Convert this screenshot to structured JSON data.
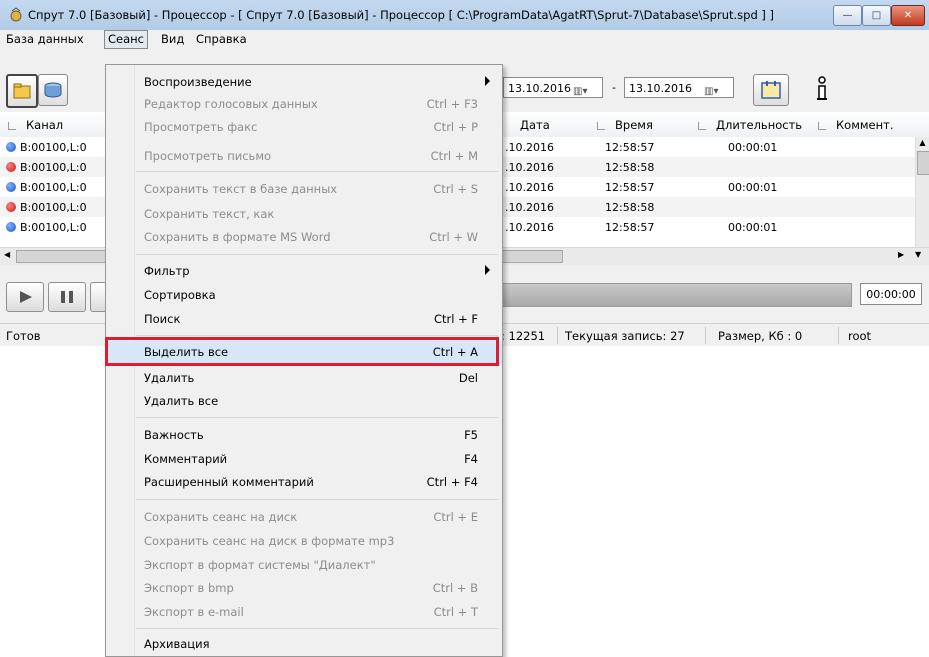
{
  "window": {
    "title": "Спрут 7.0 [Базовый] - Процессор - [ Спрут 7.0 [Базовый] - Процессор [ C:\\ProgramData\\AgatRT\\Sprut-7\\Database\\Sprut.spd ] ]"
  },
  "menubar": {
    "items": [
      "База данных",
      "Сеанс",
      "Вид",
      "Справка"
    ],
    "active": "Сеанс"
  },
  "toolbar": {
    "date_from": "13.10.2016",
    "date_to": "13.10.2016",
    "date_sep": "-"
  },
  "table": {
    "columns": [
      "Канал",
      "Дата",
      "Время",
      "Длительность",
      "Коммент."
    ],
    "rows": [
      {
        "channel": "B:00100,L:0",
        "date": ".10.2016",
        "time": "12:58:57",
        "duration": "00:00:01",
        "status": "blue"
      },
      {
        "channel": "B:00100,L:0",
        "date": ".10.2016",
        "time": "12:58:58",
        "duration": "",
        "status": "red"
      },
      {
        "channel": "B:00100,L:0",
        "date": ".10.2016",
        "time": "12:58:57",
        "duration": "00:00:01",
        "status": "blue"
      },
      {
        "channel": "B:00100,L:0",
        "date": ".10.2016",
        "time": "12:58:58",
        "duration": "",
        "status": "red"
      },
      {
        "channel": "B:00100,L:0",
        "date": ".10.2016",
        "time": "12:58:57",
        "duration": "00:00:01",
        "status": "blue"
      }
    ]
  },
  "player": {
    "time": "00:00:00"
  },
  "statusbar": {
    "ready": "Готов",
    "count": ": 12251",
    "current": "Текущая запись: 27",
    "size": "Размер, Кб : 0",
    "user": "root"
  },
  "menu": {
    "playback": "Воспроизведение",
    "voice_editor": "Редактор голосовых данных",
    "voice_editor_sc": "Ctrl + F3",
    "view_fax": "Просмотреть факс",
    "view_fax_sc": "Ctrl + P",
    "view_letter": "Просмотреть письмо",
    "view_letter_sc": "Ctrl + M",
    "save_text_db": "Сохранить текст в базе данных",
    "save_text_db_sc": "Ctrl + S",
    "save_text_as": "Сохранить текст, как",
    "save_word": "Сохранить в формате MS Word",
    "save_word_sc": "Ctrl + W",
    "filter": "Фильтр",
    "sort": "Сортировка",
    "search": "Поиск",
    "search_sc": "Ctrl + F",
    "select_all": "Выделить все",
    "select_all_sc": "Ctrl + A",
    "delete": "Удалить",
    "delete_sc": "Del",
    "delete_all": "Удалить все",
    "importance": "Важность",
    "importance_sc": "F5",
    "comment": "Комментарий",
    "comment_sc": "F4",
    "ext_comment": "Расширенный комментарий",
    "ext_comment_sc": "Ctrl + F4",
    "save_disk": "Сохранить сеанс на диск",
    "save_disk_sc": "Ctrl + E",
    "save_mp3": "Сохранить сеанс на диск в формате mp3",
    "export_dialect": "Экспорт в формат системы \"Диалект\"",
    "export_bmp": "Экспорт в bmp",
    "export_bmp_sc": "Ctrl + B",
    "export_email": "Экспорт в e-mail",
    "export_email_sc": "Ctrl + T",
    "archive": "Архивация"
  },
  "colors": {
    "highlight_border": "#e21b2d",
    "status_blue": "#1a56c8",
    "status_red": "#c21818"
  }
}
